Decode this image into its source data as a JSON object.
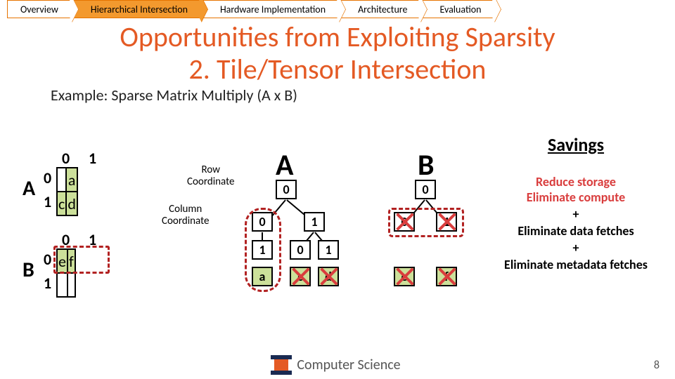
{
  "nav": {
    "items": [
      {
        "label": "Overview",
        "active": false
      },
      {
        "label": "Hierarchical Intersection",
        "active": true
      },
      {
        "label": "Hardware Implementation",
        "active": false
      },
      {
        "label": "Architecture",
        "active": false
      },
      {
        "label": "Evaluation",
        "active": false
      }
    ]
  },
  "title_line1": "Opportunities from Exploiting Sparsity",
  "title_line2": "2. Tile/Tensor Intersection",
  "example": "Example: Sparse Matrix Multiply (A x B)",
  "matA": {
    "name": "A",
    "col": [
      "0",
      "1"
    ],
    "row": [
      "0",
      "1"
    ],
    "cells": [
      [
        "",
        "a"
      ],
      [
        "c",
        "d"
      ]
    ]
  },
  "matB": {
    "name": "B",
    "col": [
      "0",
      "1"
    ],
    "row": [
      "0",
      "1"
    ],
    "cells": [
      [
        "e",
        "f"
      ],
      [
        "",
        ""
      ]
    ]
  },
  "annot": {
    "row": "Row\nCoordinate",
    "col": "Column\nCoordinate"
  },
  "tree": {
    "A": {
      "label": "A",
      "root": "0",
      "left": {
        "c": "0",
        "leaf": "1",
        "val": "a"
      },
      "right": {
        "c": "1",
        "l": {
          "c": "0",
          "v": "c"
        },
        "r": {
          "c": "1",
          "v": "d"
        }
      }
    },
    "B": {
      "label": "B",
      "root": "0",
      "l": {
        "c": "0",
        "v": "e"
      },
      "r": {
        "c": "1",
        "v": "f"
      }
    }
  },
  "savings": {
    "heading": "Savings",
    "l1": "Reduce storage",
    "l2": "Eliminate compute",
    "plus": "+",
    "l3": "Eliminate data fetches",
    "l4": "Eliminate metadata fetches"
  },
  "footer": "Computer Science",
  "page": "8"
}
